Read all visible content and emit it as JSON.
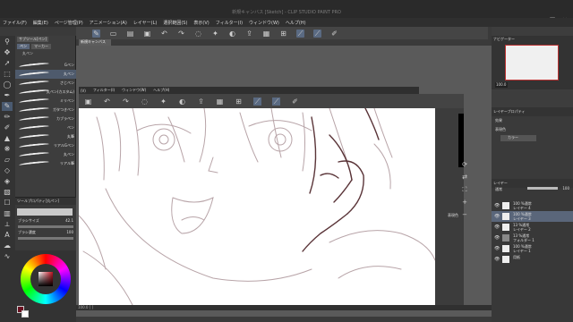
{
  "title": "新規キャンバス [Sketch] - CLIP STUDIO PAINT PRO",
  "menu": [
    "ファイル(F)",
    "編集(E)",
    "ページ管理(P)",
    "アニメーション(A)",
    "レイヤー(L)",
    "選択範囲(S)",
    "表示(V)",
    "フィルター(I)",
    "ウィンドウ(W)",
    "ヘルプ(H)"
  ],
  "file_tab": "新規キャンバス",
  "subwin_menu": [
    "(V)",
    "フィルター(I)",
    "ウィンドウ(W)",
    "ヘルプ(H)"
  ],
  "subtool": {
    "tabs": [
      "サブツール[ペン]",
      "ペン",
      "マーカー"
    ],
    "category": "丸ペン",
    "brushes": [
      "Gペン",
      "丸ペン",
      "さじペン",
      "丸ペン(カスタム)",
      "ミリペン",
      "ガタつきペン",
      "カブラペン",
      "ペン",
      "丸筆",
      "リアルGペン",
      "丸ペン",
      "リアル筆"
    ],
    "selected_index": 1
  },
  "tool_property": {
    "header": "ツールプロパティ[丸ペン]",
    "brush_size_label": "ブラシサイズ",
    "brush_size_value": "42.1",
    "opacity_label": "ブラシ濃度",
    "opacity_value": "100"
  },
  "colors": {
    "main": "#6a1020",
    "sub": "#ffffff"
  },
  "statusbar": "100.0 [ ]",
  "right": {
    "navigator_header": "ナビゲーター",
    "navigator_zoom": "100.0",
    "layer_property_header": "レイヤープロパティ",
    "effect_label": "効果",
    "expression_label": "表現色",
    "expression_value": "カラー",
    "layer_panel_header": "レイヤー",
    "blend_mode": "通常",
    "opacity": "100",
    "layers": [
      {
        "name": "100 %通常",
        "sub": "レイヤー 4"
      },
      {
        "name": "100 %通常",
        "sub": "レイヤー 3"
      },
      {
        "name": "13 %通常",
        "sub": "レイヤー 2"
      },
      {
        "name": "13 %通常",
        "sub": "フォルダー 1"
      },
      {
        "name": "100 %通常",
        "sub": "レイヤー 1"
      },
      {
        "name": "用紙",
        "sub": ""
      }
    ],
    "selected_layer": 1,
    "expression_sidelabel": "表現色"
  }
}
